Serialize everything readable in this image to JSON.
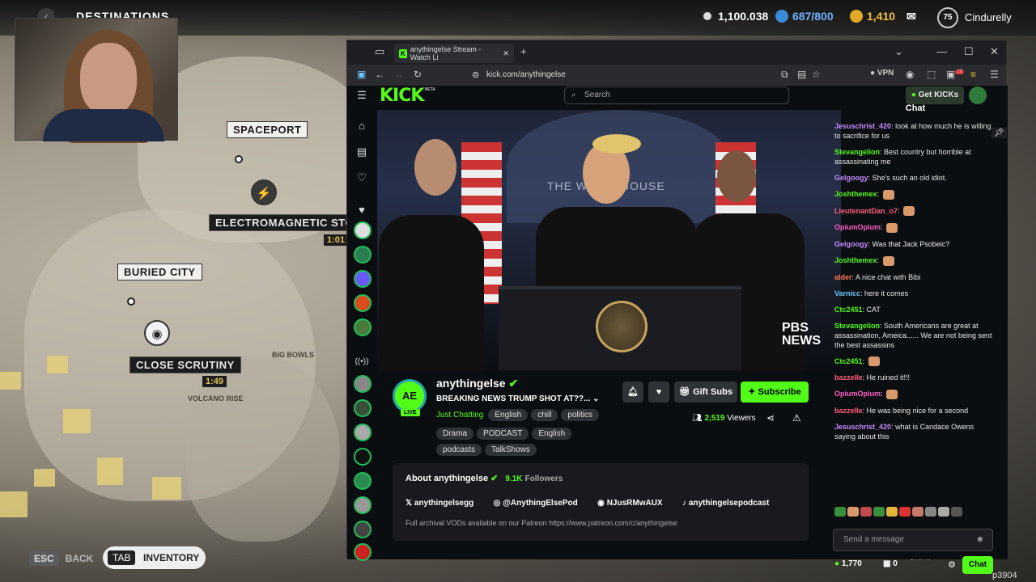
{
  "game": {
    "title": "DESTINATIONS",
    "currency_main": "1,100.038",
    "currency_token": "687/800",
    "currency_coins": "1,410",
    "level": "75",
    "username": "Cindurelly",
    "locations": [
      {
        "name": "SPACEPORT"
      },
      {
        "name": "ELECTROMAGNETIC STOR"
      },
      {
        "name": "BURIED CITY"
      },
      {
        "name": "CLOSE SCRUTINY"
      }
    ],
    "timer_storm": "1:01",
    "timer_scrutiny": "1:49",
    "map_text_1": "BIG BOWLS",
    "map_text_2": "VOLCANO RISE",
    "back_key": "ESC",
    "back_label": "BACK",
    "inv_key": "TAB",
    "inv_label": "INVENTORY",
    "chat_label": "CHAT",
    "corner_tag": "p3904"
  },
  "browser": {
    "tab_title": "anythingelse Stream - Watch Li",
    "url": "kick.com/anythingelse",
    "vpn": "VPN",
    "tab_badge": "10"
  },
  "kick": {
    "logo": "KICK",
    "logo_beta": "BETA",
    "search_placeholder": "Search",
    "get_kicks": "Get KICKs",
    "chat_title": "Chat",
    "video_watermark_1": "PBS",
    "video_watermark_2": "NEWS",
    "video_backdrop": "THE WHITE HOUSE",
    "live_badge": "LIVE",
    "avatar_text": "AE",
    "channel": "anythingelse",
    "stream_title": "BREAKING NEWS TRUMP SHOT AT??...",
    "category": "Just Chatting",
    "tags": [
      "English",
      "chill",
      "politics",
      "Drama",
      "PODCAST",
      "English",
      "podcasts",
      "TalkShows"
    ],
    "gift_subs": "Gift Subs",
    "subscribe": "Subscribe",
    "viewers_count": "2,519",
    "viewers_label": "Viewers",
    "about_title": "About anythingelse",
    "followers": "9.1K",
    "followers_label": "Followers",
    "socials": [
      "anythingelsegg",
      "@AnythingElsePod",
      "NJusRMwAUX",
      "anythingelsepodcast"
    ],
    "description": "Full archival VODs available on our Patreon https://www.patreon.com/c/anythingelse",
    "chat_messages": [
      {
        "user": "Jesuschrist_420",
        "text": "look at how much he is willing to sacrifice for us",
        "color": "#c68cff"
      },
      {
        "user": "Stevangelion",
        "text": "Best country but horrible at assassinating me",
        "color": "#53fc18"
      },
      {
        "user": "Gelgoogy",
        "text": "She's such an old idiot.",
        "color": "#c68cff"
      },
      {
        "user": "Joshthemex",
        "text": "",
        "color": "#53fc18"
      },
      {
        "user": "LieutenantDan_o7",
        "text": "",
        "color": "#ff5f7a"
      },
      {
        "user": "OpiumOpium",
        "text": "",
        "color": "#ff5fc8"
      },
      {
        "user": "Gelgoogy",
        "text": "Was that Jack Psobeic?",
        "color": "#c68cff"
      },
      {
        "user": "Joshthemex",
        "text": "",
        "color": "#53fc18"
      },
      {
        "user": "alder",
        "text": "A nice chat with Bibi",
        "color": "#ff7a59"
      },
      {
        "user": "Varnicc",
        "text": "here it comes",
        "color": "#6ec6ff"
      },
      {
        "user": "Ctc2451",
        "text": "CAT",
        "color": "#53fc18"
      },
      {
        "user": "Stevangelion",
        "text": "South Americans are great at assassination, Ameica...... We are not being sent the best assassins",
        "color": "#53fc18"
      },
      {
        "user": "Ctc2451",
        "text": "",
        "color": "#53fc18"
      },
      {
        "user": "bazzelle",
        "text": "He ruined it!!!",
        "color": "#ff5f7a"
      },
      {
        "user": "OpiumOpium",
        "text": "",
        "color": "#ff5fc8"
      },
      {
        "user": "bazzelle",
        "text": "He was being nice for a second",
        "color": "#ff5f7a"
      },
      {
        "user": "Jesuschrist_420",
        "text": "what is Candace Owens saying about this",
        "color": "#c68cff"
      },
      {
        "user": "LieutenantDan_o7",
        "text": "",
        "color": "#ff5f7a"
      }
    ],
    "chat_placeholder": "Send a message",
    "kicks_balance": "1,770",
    "points": "0",
    "chat_button": "Chat"
  },
  "colors": {
    "kick_green": "#53fc18",
    "map_label": "#f1f0ed"
  }
}
